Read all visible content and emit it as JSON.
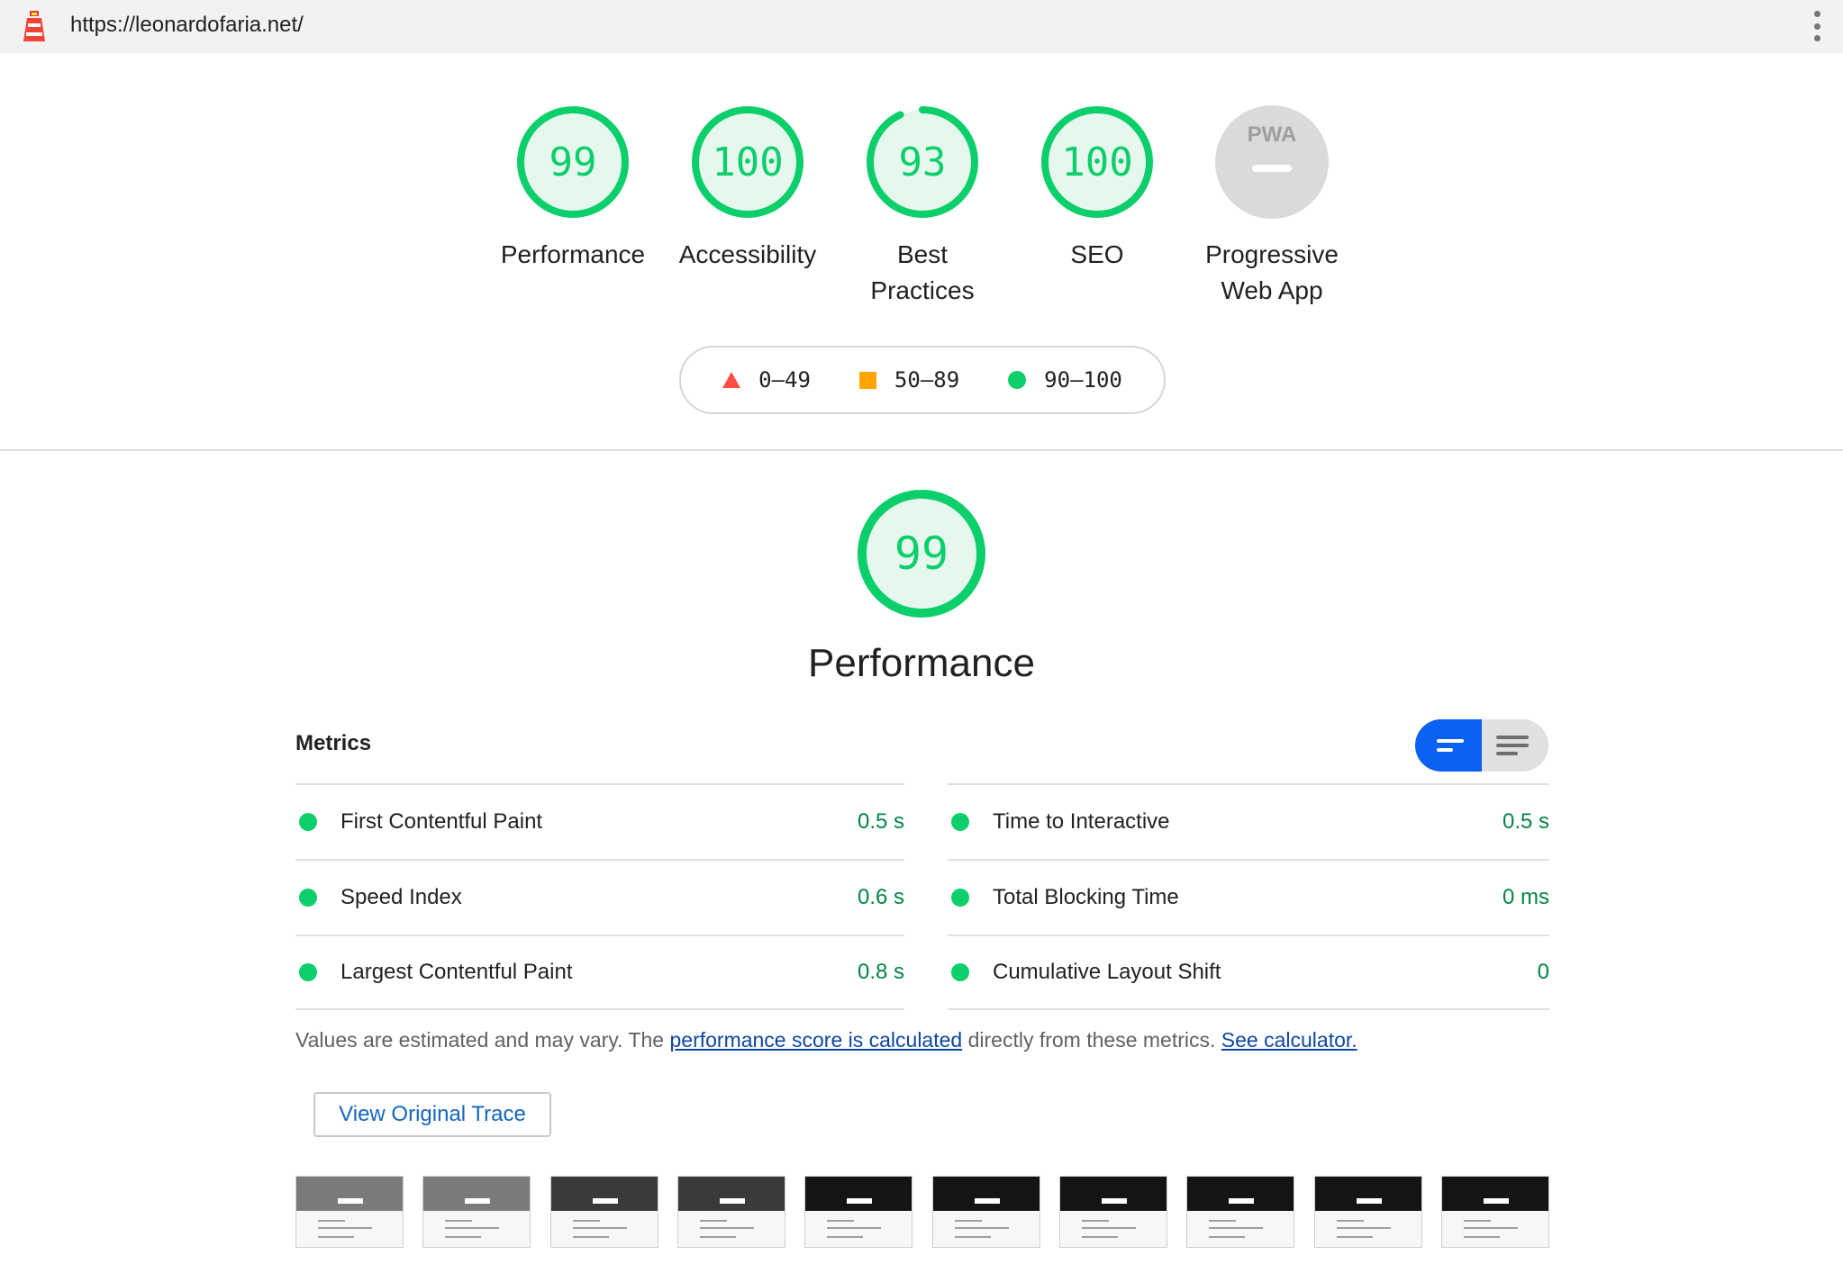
{
  "browser": {
    "url": "https://leonardofaria.net/"
  },
  "gauges": [
    {
      "id": "performance",
      "score": "99",
      "label": "Performance",
      "fraction": 0.99
    },
    {
      "id": "accessibility",
      "score": "100",
      "label": "Accessibility",
      "fraction": 1.0
    },
    {
      "id": "best-practices",
      "score": "93",
      "label": "Best Practices",
      "fraction": 0.93
    },
    {
      "id": "seo",
      "score": "100",
      "label": "SEO",
      "fraction": 1.0
    },
    {
      "id": "pwa",
      "score": "PWA",
      "label": "Progressive Web App"
    }
  ],
  "legend": {
    "fail": "0–49",
    "average": "50–89",
    "pass": "90–100"
  },
  "performance": {
    "score": "99",
    "fraction": 0.99,
    "title": "Performance"
  },
  "metrics": {
    "title": "Metrics",
    "left": [
      {
        "name": "First Contentful Paint",
        "value": "0.5 s"
      },
      {
        "name": "Speed Index",
        "value": "0.6 s"
      },
      {
        "name": "Largest Contentful Paint",
        "value": "0.8 s"
      }
    ],
    "right": [
      {
        "name": "Time to Interactive",
        "value": "0.5 s"
      },
      {
        "name": "Total Blocking Time",
        "value": "0 ms"
      },
      {
        "name": "Cumulative Layout Shift",
        "value": "0"
      }
    ]
  },
  "note": {
    "part1": "Values are estimated and may vary. The ",
    "link1": "performance score is calculated",
    "part2": " directly from these metrics. ",
    "link2": "See calculator."
  },
  "trace_button": "View Original Trace",
  "colors": {
    "pass": "#0cce6b",
    "pass_text": "#018642",
    "average": "#ffa400",
    "fail": "#ff4e42",
    "toggle_active": "#0b61f2"
  }
}
